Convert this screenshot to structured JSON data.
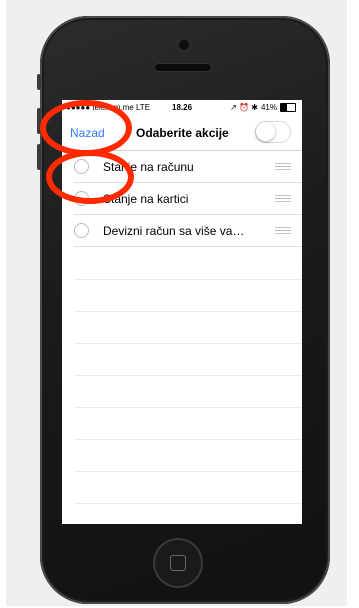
{
  "status_bar": {
    "carrier": "●●●●● telekom.me  LTE",
    "time": "18.26",
    "indicators": "↗ ⏰ ✱",
    "battery_text": "41%",
    "battery_level": 0.41
  },
  "navbar": {
    "back_label": "Nazad",
    "title": "Odaberite akcije",
    "toggle_on": false
  },
  "items": [
    {
      "label": "Stanje na računu"
    },
    {
      "label": "Stanje na kartici"
    },
    {
      "label": "Devizni račun sa više va…"
    }
  ],
  "colors": {
    "accent": "#2f7bf5",
    "annotation": "#ff2a00"
  }
}
